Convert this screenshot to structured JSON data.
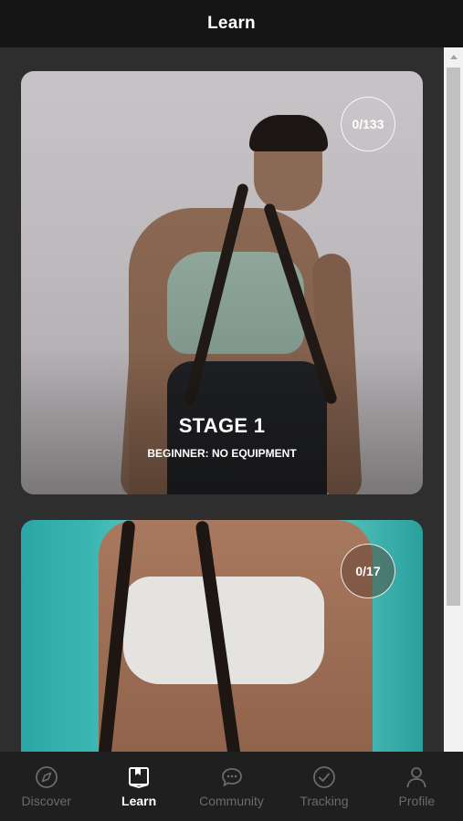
{
  "header": {
    "title": "Learn"
  },
  "cards": [
    {
      "badge": "0/133",
      "title": "STAGE 1",
      "subtitle": "BEGINNER: NO EQUIPMENT"
    },
    {
      "badge": "0/17"
    }
  ],
  "tabs": [
    {
      "label": "Discover",
      "icon": "compass-icon",
      "active": false
    },
    {
      "label": "Learn",
      "icon": "book-icon",
      "active": true
    },
    {
      "label": "Community",
      "icon": "chat-icon",
      "active": false
    },
    {
      "label": "Tracking",
      "icon": "check-circle-icon",
      "active": false
    },
    {
      "label": "Profile",
      "icon": "person-icon",
      "active": false
    }
  ]
}
